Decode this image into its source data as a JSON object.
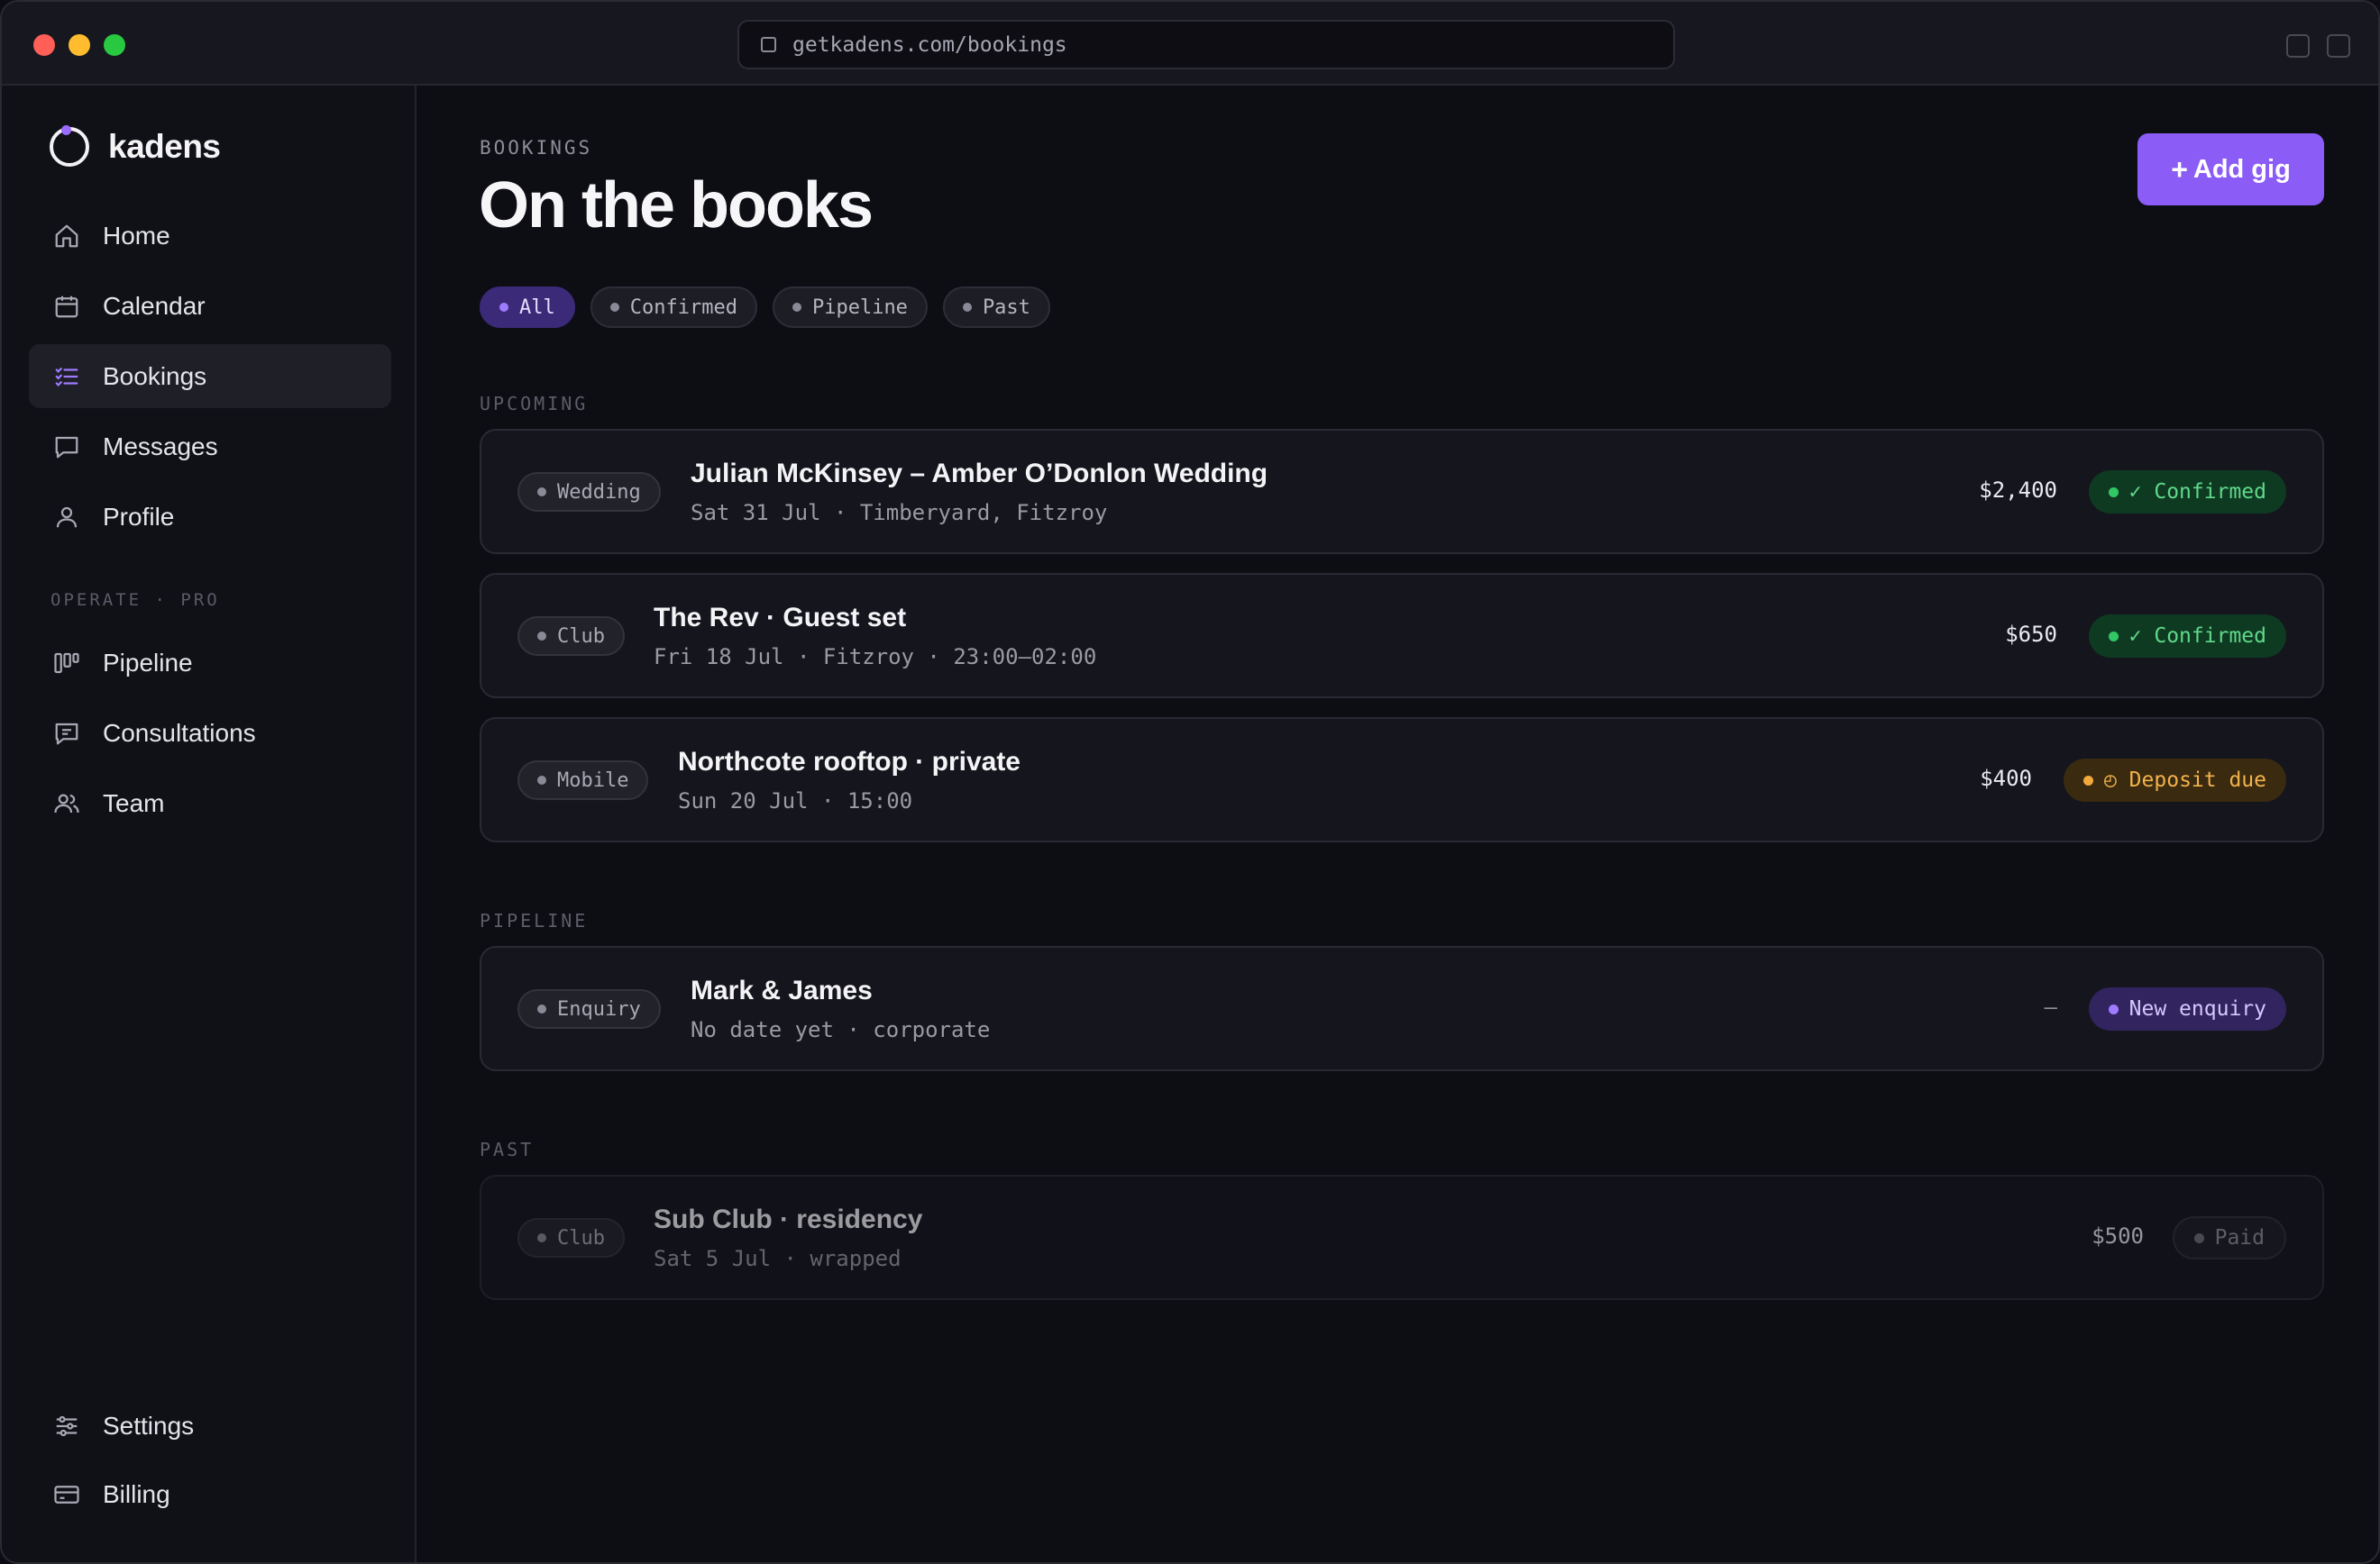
{
  "browser": {
    "url": "getkadens.com/bookings"
  },
  "sidebar": {
    "logo": "kadens",
    "items": [
      {
        "label": "Home",
        "icon": "home-icon"
      },
      {
        "label": "Calendar",
        "icon": "calendar-icon"
      },
      {
        "label": "Bookings",
        "icon": "list-icon",
        "active": true
      },
      {
        "label": "Messages",
        "icon": "message-icon"
      },
      {
        "label": "Profile",
        "icon": "user-icon"
      }
    ],
    "section_label": "OPERATE · PRO",
    "pro_items": [
      {
        "label": "Pipeline",
        "icon": "pipeline-icon"
      },
      {
        "label": "Consultations",
        "icon": "chat-icon"
      },
      {
        "label": "Team",
        "icon": "team-icon"
      }
    ],
    "bottom_items": [
      {
        "label": "Settings",
        "icon": "sliders-icon"
      },
      {
        "label": "Billing",
        "icon": "card-icon"
      }
    ]
  },
  "header": {
    "eyebrow": "BOOKINGS",
    "title": "On the books",
    "add_button": "Add gig",
    "add_button_icon": "+"
  },
  "filters": [
    {
      "label": "All",
      "active": true
    },
    {
      "label": "Confirmed"
    },
    {
      "label": "Pipeline"
    },
    {
      "label": "Past"
    }
  ],
  "sections": {
    "upcoming": "UPCOMING",
    "pipeline": "PIPELINE",
    "past": "PAST"
  },
  "bookings": {
    "upcoming": [
      {
        "tag": "Wedding",
        "title": "Julian McKinsey – Amber O’Donlon Wedding",
        "subtitle": "Sat 31 Jul · Timberyard, Fitzroy",
        "amount": "$2,400",
        "status": "✓ Confirmed"
      },
      {
        "tag": "Club",
        "title": "The Rev · Guest set",
        "subtitle": "Fri 18 Jul · Fitzroy · 23:00–02:00",
        "amount": "$650",
        "status": "✓ Confirmed"
      },
      {
        "tag": "Mobile",
        "title": "Northcote rooftop · private",
        "subtitle": "Sun 20 Jul · 15:00",
        "amount": "$400",
        "status": "◴ Deposit due"
      }
    ],
    "pipeline": [
      {
        "tag": "Enquiry",
        "title": "Mark & James",
        "subtitle": "No date yet · corporate",
        "amount": "—",
        "status": "New enquiry"
      }
    ],
    "past": [
      {
        "tag": "Club",
        "title": "Sub Club · residency",
        "subtitle": "Sat 5 Jul · wrapped",
        "amount": "$500",
        "status": "Paid"
      }
    ]
  },
  "colors": {
    "accent": "#8b5cf6",
    "confirmed": "#32c766",
    "deposit": "#f2a93b",
    "background": "#0d0d14"
  }
}
